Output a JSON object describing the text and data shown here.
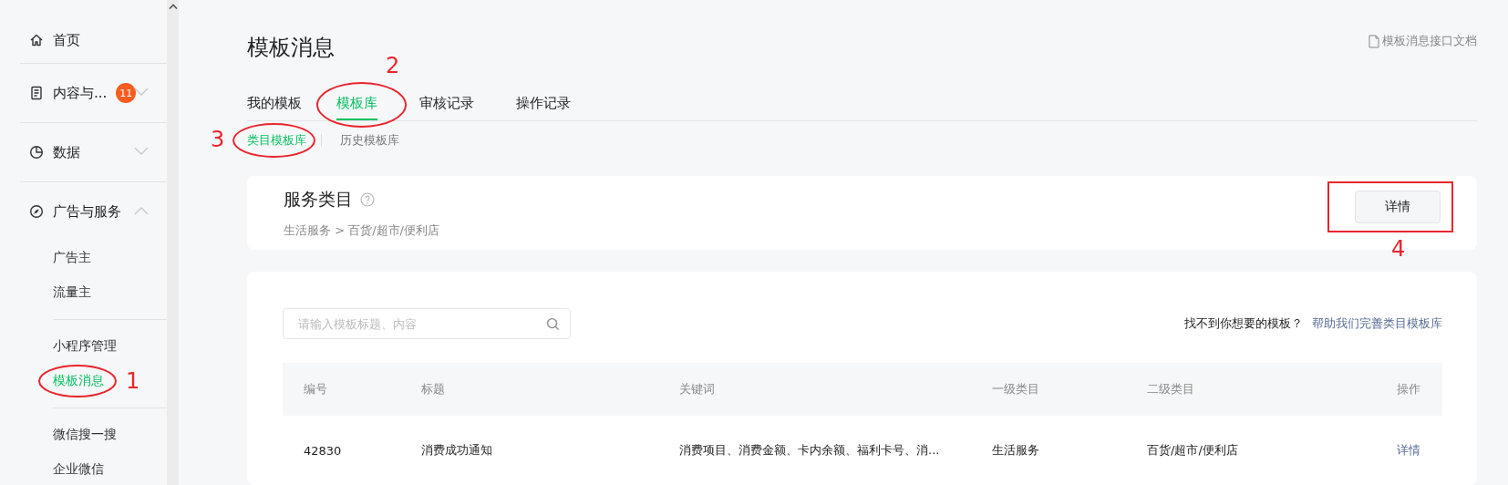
{
  "sidebar": {
    "items": [
      {
        "label": "首页"
      },
      {
        "label": "内容与...",
        "badge": "11",
        "expanded": false
      },
      {
        "label": "数据",
        "expanded": false
      },
      {
        "label": "广告与服务",
        "expanded": true,
        "groups": [
          [
            {
              "label": "广告主",
              "selected": false
            },
            {
              "label": "流量主",
              "selected": false
            }
          ],
          [
            {
              "label": "小程序管理",
              "selected": false
            },
            {
              "label": "模板消息",
              "selected": true,
              "annotation": {
                "kind": "ellipse",
                "label": "1"
              }
            }
          ],
          [
            {
              "label": "微信搜一搜",
              "selected": false
            },
            {
              "label": "企业微信",
              "selected": false
            }
          ]
        ]
      }
    ]
  },
  "page": {
    "title": "模板消息",
    "doc_link": "模板消息接口文档"
  },
  "tabs": [
    {
      "label": "我的模板",
      "selected": false
    },
    {
      "label": "模板库",
      "selected": true,
      "annotation": {
        "kind": "ellipse",
        "label": "2"
      }
    },
    {
      "label": "审核记录",
      "selected": false
    },
    {
      "label": "操作记录",
      "selected": false
    }
  ],
  "subtabs": [
    {
      "label": "类目模板库",
      "selected": true,
      "annotation": {
        "kind": "ellipse",
        "label": "3"
      }
    },
    {
      "label": "历史模板库",
      "selected": false
    }
  ],
  "category_card": {
    "title": "服务类目",
    "path": "生活服务 > 百货/超市/便利店",
    "button": {
      "label": "详情",
      "annotation": {
        "kind": "rect",
        "label": "4"
      }
    }
  },
  "search": {
    "placeholder": "请输入模板标题、内容"
  },
  "hint": {
    "text": "找不到你想要的模板？",
    "link": "帮助我们完善类目模板库"
  },
  "table": {
    "columns": [
      "编号",
      "标题",
      "关键词",
      "一级类目",
      "二级类目",
      "操作"
    ],
    "rows": [
      {
        "cells": [
          "42830",
          "消费成功通知",
          "消费项目、消费金额、卡内余额、福利卡号、消...",
          "生活服务",
          "百货/超市/便利店"
        ],
        "action": "详情"
      }
    ]
  }
}
